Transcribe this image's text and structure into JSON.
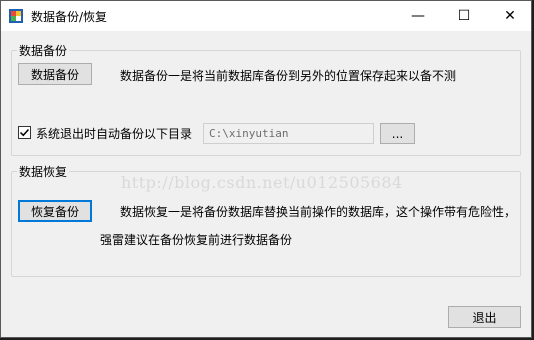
{
  "window": {
    "title": "数据备份/恢复",
    "controls": {
      "minimize": "—",
      "maximize": "☐",
      "close": "✕"
    }
  },
  "backup_group": {
    "label": "数据备份",
    "button_label": "数据备份",
    "description": "数据备份一是将当前数据库备份到另外的位置保存起来以备不测",
    "checkbox_label": "系统退出时自动备份以下目录",
    "checkbox_checked": true,
    "path_value": "C:\\xinyutian",
    "browse_label": "..."
  },
  "restore_group": {
    "label": "数据恢复",
    "button_label": "恢复备份",
    "description_line1": "数据恢复一是将备份数据库替换当前操作的数据库，这个操作带有危险性，",
    "description_line2": "强雷建议在备份恢复前进行数据备份"
  },
  "watermark": "http://blog.csdn.net/u012505684",
  "exit_label": "退出",
  "colors": {
    "accent": "#0078d7",
    "window_bg": "#f0f0f0"
  }
}
